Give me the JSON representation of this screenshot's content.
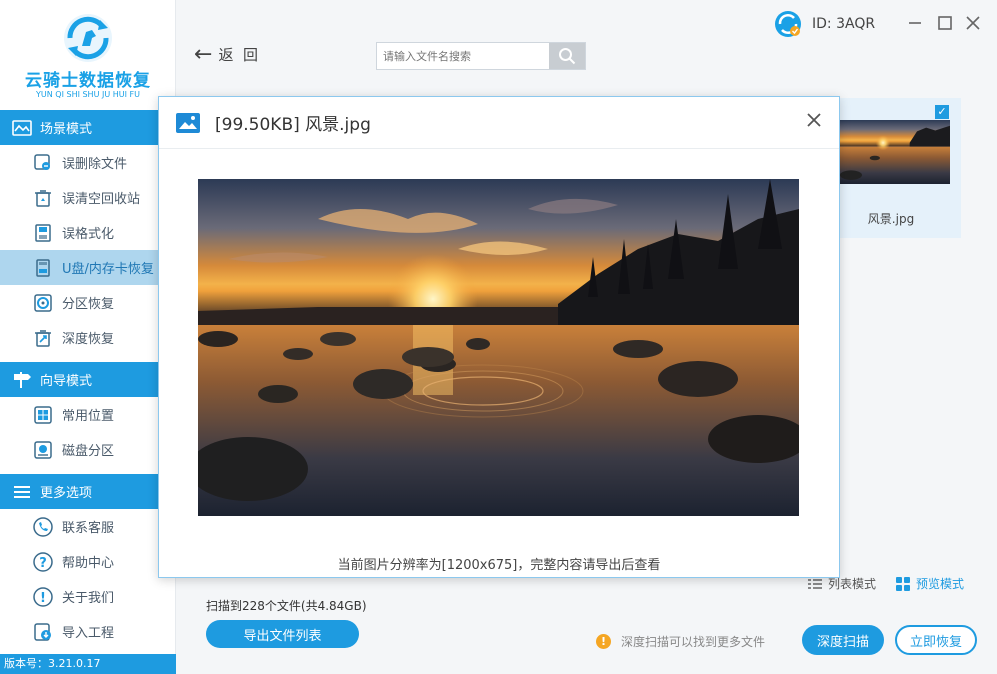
{
  "app": {
    "logo_title": "云骑士数据恢复",
    "logo_subtitle": "YUN QI SHI SHU JU HUI FU",
    "version": "版本号：3.21.0.17"
  },
  "sidebar": {
    "sections": [
      {
        "label": "场景模式",
        "icon": "scene-icon",
        "items": [
          {
            "label": "误删除文件",
            "icon": "deleted-file-icon"
          },
          {
            "label": "误清空回收站",
            "icon": "recycle-bin-icon"
          },
          {
            "label": "误格式化",
            "icon": "format-icon"
          },
          {
            "label": "U盘/内存卡恢复",
            "icon": "usb-card-icon",
            "active": true
          },
          {
            "label": "分区恢复",
            "icon": "partition-icon"
          },
          {
            "label": "深度恢复",
            "icon": "deep-recover-icon"
          }
        ]
      },
      {
        "label": "向导模式",
        "icon": "signpost-icon",
        "items": [
          {
            "label": "常用位置",
            "icon": "windows-location-icon"
          },
          {
            "label": "磁盘分区",
            "icon": "disk-partition-icon"
          }
        ]
      },
      {
        "label": "更多选项",
        "icon": "menu-icon",
        "items": [
          {
            "label": "联系客服",
            "icon": "phone-icon"
          },
          {
            "label": "帮助中心",
            "icon": "help-icon"
          },
          {
            "label": "关于我们",
            "icon": "info-icon"
          },
          {
            "label": "导入工程",
            "icon": "import-icon"
          }
        ]
      }
    ]
  },
  "toolbar": {
    "back_label": "返  回",
    "search_placeholder": "请输入文件名搜索",
    "user_id": "ID: 3AQR"
  },
  "files": [
    {
      "name": "风景.jpg",
      "checked": true
    }
  ],
  "view": {
    "list_label": "列表模式",
    "preview_label": "预览模式",
    "active": "preview"
  },
  "status": {
    "scan_info": "扫描到228个文件(共4.84GB)",
    "export_label": "导出文件列表",
    "tip": "深度扫描可以找到更多文件",
    "deep_scan_label": "深度扫描",
    "recover_label": "立即恢复"
  },
  "preview_modal": {
    "title": "[99.50KB] 风景.jpg",
    "footer": "当前图片分辨率为[1200x675]，完整内容请导出后查看"
  },
  "colors": {
    "accent": "#1e9be0",
    "active_item_bg": "#aed6ee",
    "warning": "#f5a623"
  }
}
